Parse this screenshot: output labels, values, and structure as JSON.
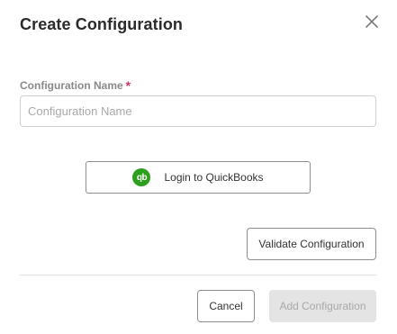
{
  "dialog": {
    "title": "Create Configuration",
    "close_icon": "close-icon"
  },
  "form": {
    "name_label": "Configuration Name",
    "required_marker": "*",
    "name_placeholder": "Configuration Name",
    "name_value": ""
  },
  "quickbooks": {
    "button_label": "Login to QuickBooks",
    "icon": "quickbooks-logo-icon",
    "icon_text": "qb",
    "brand_color": "#2ca01c"
  },
  "actions": {
    "validate_label": "Validate Configuration",
    "cancel_label": "Cancel",
    "add_label": "Add Configuration",
    "add_disabled": true
  },
  "colors": {
    "required": "#d6336c",
    "disabled_bg": "#e4e4e4",
    "disabled_text": "#a9a9a9"
  }
}
